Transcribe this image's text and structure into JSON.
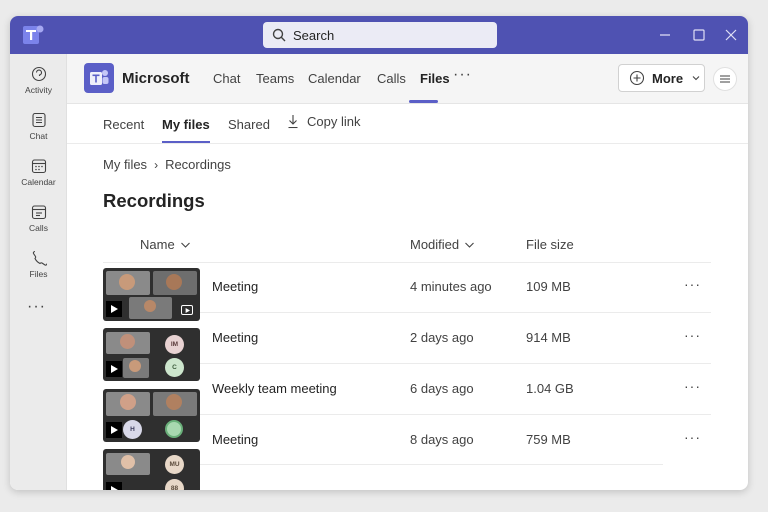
{
  "search": {
    "label": "Search"
  },
  "sidebar": {
    "items": [
      {
        "label": "Activity",
        "icon": "activity-icon"
      },
      {
        "label": "Chat",
        "icon": "chat-icon"
      },
      {
        "label": "Calendar",
        "icon": "calendar-icon"
      },
      {
        "label": "Calls",
        "icon": "calls-icon"
      },
      {
        "label": "Files",
        "icon": "files-icon"
      }
    ],
    "more": "···"
  },
  "header": {
    "brand": "Microsoft",
    "tabs": [
      "Chat",
      "Teams",
      "Calendar",
      "Calls",
      "Files"
    ],
    "active_tab": "Files",
    "overflow": "···",
    "more_button": "More"
  },
  "subtabs": {
    "items": [
      "Recent",
      "My files",
      "Shared"
    ],
    "active": "My files",
    "copy_link": "Copy link"
  },
  "breadcrumb": {
    "root": "My files",
    "separator": "›",
    "current": "Recordings"
  },
  "page_title": "Recordings",
  "table": {
    "columns": {
      "name": "Name",
      "modified": "Modified",
      "size": "File size"
    },
    "rows": [
      {
        "name": "Meeting",
        "modified": "4 minutes ago",
        "size": "109 MB",
        "actions": "···"
      },
      {
        "name": "Meeting",
        "modified": "2 days ago",
        "size": "914 MB",
        "actions": "···",
        "initials": [
          "IM",
          "C"
        ]
      },
      {
        "name": "Weekly team meeting",
        "modified": "6 days ago",
        "size": "1.04 GB",
        "actions": "···",
        "initials": [
          "H"
        ]
      },
      {
        "name": "Meeting",
        "modified": "8 days ago",
        "size": "759 MB",
        "actions": "···",
        "initials": [
          "MU",
          "88"
        ]
      }
    ]
  },
  "colors": {
    "titlebar": "#4f52b2",
    "accent": "#5b5fc7"
  }
}
